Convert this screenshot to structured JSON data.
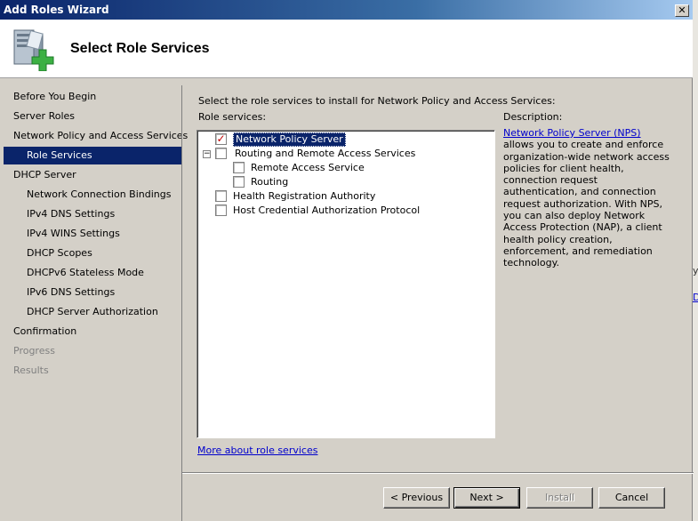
{
  "window": {
    "title": "Add Roles Wizard",
    "close_glyph": "✕"
  },
  "header": {
    "title": "Select Role Services",
    "icon": "server-add-icon"
  },
  "sidebar": {
    "items": [
      {
        "label": "Before You Begin",
        "state": "normal",
        "level": 0
      },
      {
        "label": "Server Roles",
        "state": "normal",
        "level": 0
      },
      {
        "label": "Network Policy and Access Services",
        "state": "normal",
        "level": 0
      },
      {
        "label": "Role Services",
        "state": "selected",
        "level": 1
      },
      {
        "label": "DHCP Server",
        "state": "normal",
        "level": 0
      },
      {
        "label": "Network Connection Bindings",
        "state": "normal",
        "level": 1
      },
      {
        "label": "IPv4 DNS Settings",
        "state": "normal",
        "level": 1
      },
      {
        "label": "IPv4 WINS Settings",
        "state": "normal",
        "level": 1
      },
      {
        "label": "DHCP Scopes",
        "state": "normal",
        "level": 1
      },
      {
        "label": "DHCPv6 Stateless Mode",
        "state": "normal",
        "level": 1
      },
      {
        "label": "IPv6 DNS Settings",
        "state": "normal",
        "level": 1
      },
      {
        "label": "DHCP Server Authorization",
        "state": "normal",
        "level": 1
      },
      {
        "label": "Confirmation",
        "state": "normal",
        "level": 0
      },
      {
        "label": "Progress",
        "state": "disabled",
        "level": 0
      },
      {
        "label": "Results",
        "state": "disabled",
        "level": 0
      }
    ]
  },
  "main": {
    "instruction": "Select the role services to install for Network Policy and Access Services:",
    "role_services_label": "Role services:",
    "tree": [
      {
        "label": "Network Policy Server",
        "checked": true,
        "selected": true
      },
      {
        "label": "Routing and Remote Access Services",
        "checked": false,
        "expander": "−"
      },
      {
        "label": "Remote Access Service",
        "checked": false
      },
      {
        "label": "Routing",
        "checked": false
      },
      {
        "label": "Health Registration Authority",
        "checked": false
      },
      {
        "label": "Host Credential Authorization Protocol",
        "checked": false
      }
    ],
    "check_glyph": "✓",
    "description_label": "Description:",
    "description_link": "Network Policy Server (NPS)",
    "description_text": " allows you to create and enforce organization-wide network access policies for client health, connection request authentication, and connection request authorization. With NPS, you can also deploy Network Access Protection (NAP), a client health policy creation, enforcement, and remediation technology.",
    "more_link": "More about role services"
  },
  "buttons": {
    "previous": "< Previous",
    "next": "Next >",
    "install": "Install",
    "cancel": "Cancel"
  },
  "right_edge": {
    "frag1": "y",
    "frag2": "D"
  }
}
